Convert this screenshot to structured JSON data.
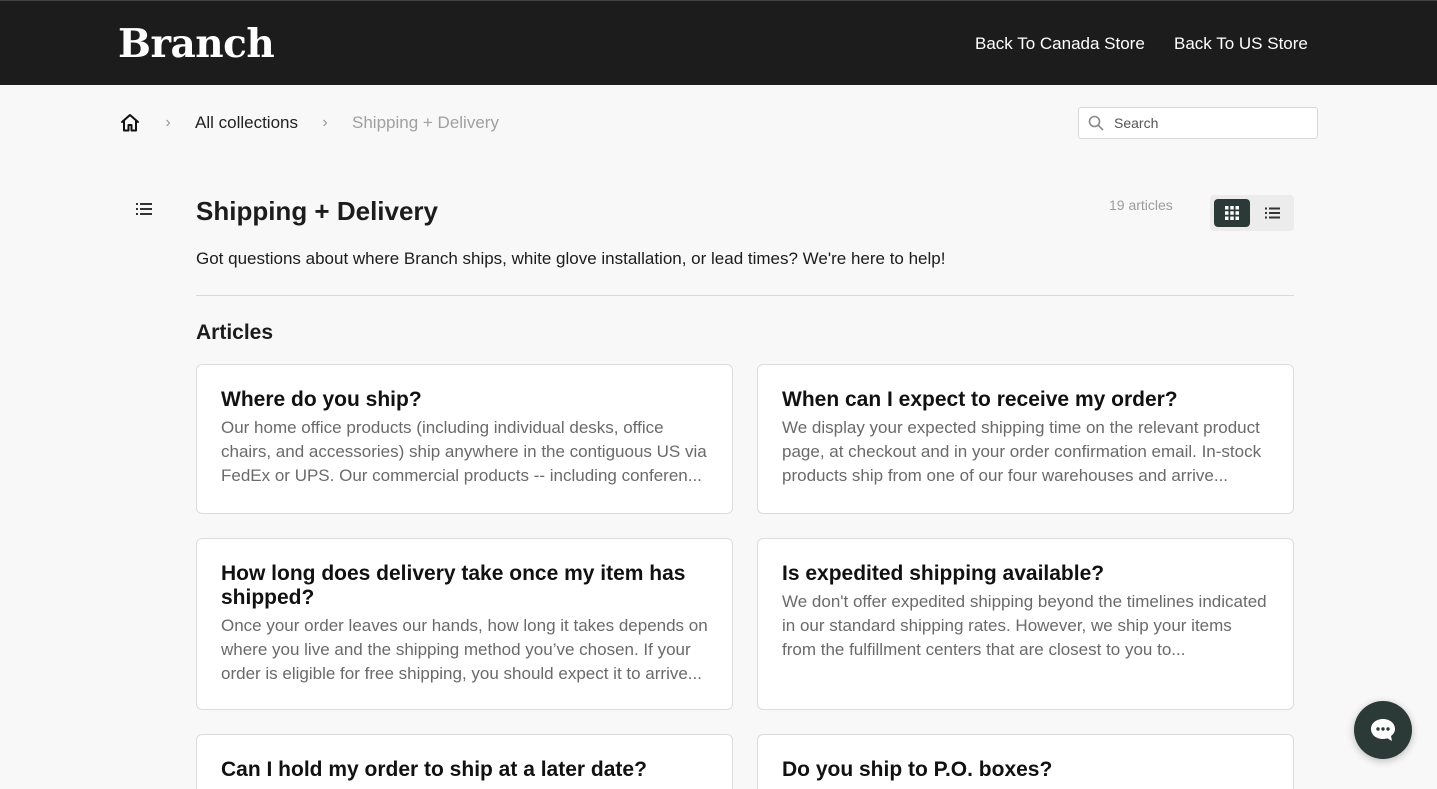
{
  "header": {
    "logo": "Branch",
    "links": [
      "Back To Canada Store",
      "Back To US Store"
    ]
  },
  "breadcrumb": {
    "home_icon": "home-icon",
    "items": [
      "All collections",
      "Shipping + Delivery"
    ]
  },
  "search": {
    "placeholder": "Search",
    "value": ""
  },
  "collection": {
    "title": "Shipping + Delivery",
    "count": "19 articles",
    "description": "Got questions about where Branch ships, white glove installation, or lead times? We're here to help!",
    "view_mode": "grid"
  },
  "articles_heading": "Articles",
  "articles": [
    {
      "title": "Where do you ship?",
      "excerpt": "Our home office products (including individual desks, office chairs, and accessories) ship anywhere in the contiguous US via FedEx or UPS. Our commercial products -- including conferen..."
    },
    {
      "title": "When can I expect to receive my order?",
      "excerpt": "We display your expected shipping time on the relevant product page, at checkout and in your order confirmation email. In-stock products ship from one of our four warehouses and arrive..."
    },
    {
      "title": "How long does delivery take once my item has shipped?",
      "excerpt": "Once your order leaves our hands, how long it takes depends on where you live and the shipping method you’ve chosen. If your order is eligible for free shipping, you should expect it to arrive..."
    },
    {
      "title": "Is expedited shipping available?",
      "excerpt": "We don't offer expedited shipping beyond the timelines indicated in our standard shipping rates. However, we ship your items from the fulfillment centers that are closest to you to..."
    },
    {
      "title": "Can I hold my order to ship at a later date?",
      "excerpt": ""
    },
    {
      "title": "Do you ship to P.O. boxes?",
      "excerpt": ""
    }
  ],
  "colors": {
    "header_bg": "#1c1c1c",
    "accent": "#2b3a36",
    "page_bg": "#f8f8f8"
  }
}
